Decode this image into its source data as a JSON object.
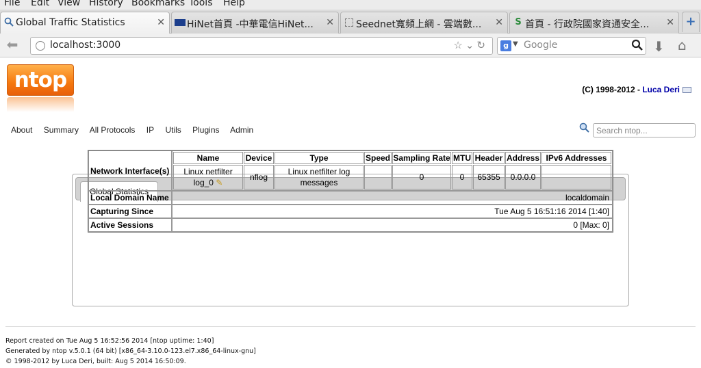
{
  "browser": {
    "menu": [
      "File",
      "Edit",
      "View",
      "History",
      "Bookmarks",
      "Tools",
      "Help"
    ],
    "tabs": [
      {
        "label": "Global Traffic Statistics",
        "icon": "search-icon",
        "close": "✕"
      },
      {
        "label": "HiNet首頁 -中華電信HiNet...",
        "icon": "hinet-favicon",
        "close": "✕"
      },
      {
        "label": "Seednet寬頻上網 - 雲端數...",
        "icon": "page-favicon",
        "close": "✕"
      },
      {
        "label": "首頁 - 行政院國家資通安全...",
        "icon": "gov-favicon",
        "close": "✕"
      }
    ],
    "new_tab": "+",
    "url": "localhost:3000",
    "search_placeholder": "Google",
    "search_engine": "g"
  },
  "page": {
    "logo": "ntop",
    "copyright_prefix": "(C) 1998-2012 - ",
    "copyright_author": "Luca Deri",
    "menu": [
      "About",
      "Summary",
      "All Protocols",
      "IP",
      "Utils",
      "Plugins",
      "Admin"
    ],
    "search_placeholder": "Search ntop...",
    "panel_tab": "Global Statistics",
    "table": {
      "network_label": "Network Interface(s)",
      "columns": [
        "Name",
        "Device",
        "Type",
        "Speed",
        "Sampling Rate",
        "MTU",
        "Header",
        "Address",
        "IPv6 Addresses"
      ],
      "row": {
        "name": "Linux netfilter log_0",
        "device": "nflog",
        "type": "Linux netfilter log messages",
        "speed": "",
        "sampling_rate": "0",
        "mtu": "0",
        "header": "65355",
        "address": "0.0.0.0",
        "ipv6": ""
      },
      "local_domain_label": "Local Domain Name",
      "local_domain_value": "localdomain",
      "capturing_label": "Capturing Since",
      "capturing_value": "Tue Aug 5 16:51:16 2014 [1:40]",
      "sessions_label": "Active Sessions",
      "sessions_value": "0 [Max: 0]"
    },
    "footer": [
      "Report created on Tue Aug 5 16:52:56 2014 [ntop uptime: 1:40]",
      "Generated by ntop v.5.0.1 (64 bit) [x86_64-3.10.0-123.el7.x86_64-linux-gnu]",
      "© 1998-2012 by Luca Deri, built: Aug 5 2014 16:50:09."
    ]
  }
}
